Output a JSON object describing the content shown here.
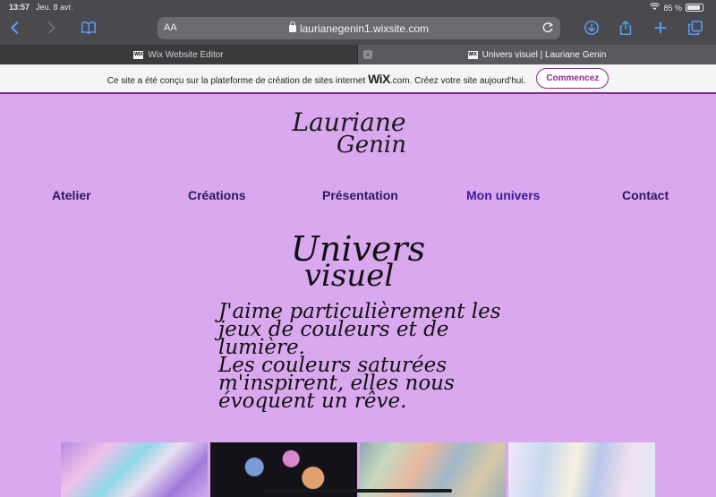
{
  "status": {
    "time": "13:57",
    "date": "Jeu. 8 avr.",
    "battery": "85 %"
  },
  "browser": {
    "text_size_label": "AA",
    "url": "laurianegenin1.wixsite.com",
    "tabs": [
      {
        "label": "Wix Website Editor",
        "favicon": "WIX",
        "active": false
      },
      {
        "label": "Univers visuel | Lauriane Genin",
        "favicon": "WIX",
        "active": true
      }
    ]
  },
  "banner": {
    "text": "Ce site a été conçu sur la plateforme de création de sites internet",
    "logo": "WiX",
    "text_after": ".com. Créez votre site aujourd'hui.",
    "button": "Commencez",
    "accent": "#8a2c8e"
  },
  "site": {
    "logo_line1": "Lauriane",
    "logo_line2": "Genin",
    "menu": [
      "Atelier",
      "Créations",
      "Présentation",
      "Mon univers",
      "Contact"
    ],
    "title_line1": "Univers",
    "title_line2": "visuel",
    "paragraph": [
      "J'aime particulièrement les",
      "jeux de couleurs et de",
      "lumière.",
      "Les couleurs saturées",
      "m'inspirent, elles nous",
      "évoquent un rêve."
    ],
    "background": "#d9a8ee"
  }
}
